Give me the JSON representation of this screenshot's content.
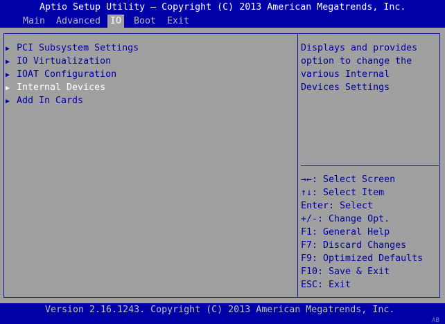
{
  "header": {
    "title": "Aptio Setup Utility – Copyright (C) 2013 American Megatrends, Inc.",
    "tabs": [
      {
        "label": "Main"
      },
      {
        "label": "Advanced"
      },
      {
        "label": "IO",
        "active": true
      },
      {
        "label": "Boot"
      },
      {
        "label": "Exit"
      }
    ]
  },
  "menu": {
    "items": [
      {
        "label": "PCI Subsystem Settings"
      },
      {
        "label": "IO Virtualization"
      },
      {
        "label": "IOAT Configuration"
      },
      {
        "label": "Internal Devices",
        "selected": true
      },
      {
        "label": "Add In Cards"
      }
    ]
  },
  "help": {
    "lines": [
      "Displays and provides",
      "option to change the",
      "various Internal",
      "Devices Settings"
    ]
  },
  "keys": [
    "→←: Select Screen",
    "↑↓: Select Item",
    "Enter: Select",
    "+/-: Change Opt.",
    "F1: General Help",
    "F7: Discard Changes",
    "F9: Optimized Defaults",
    "F10: Save & Exit",
    "ESC: Exit"
  ],
  "footer": {
    "text": "Version 2.16.1243. Copyright (C) 2013 American Megatrends, Inc.",
    "corner": "AB"
  },
  "colors": {
    "blue": "#0000a8",
    "gray": "#a0a0a0",
    "text": "#0000a0",
    "highlight": "#ffffff"
  }
}
